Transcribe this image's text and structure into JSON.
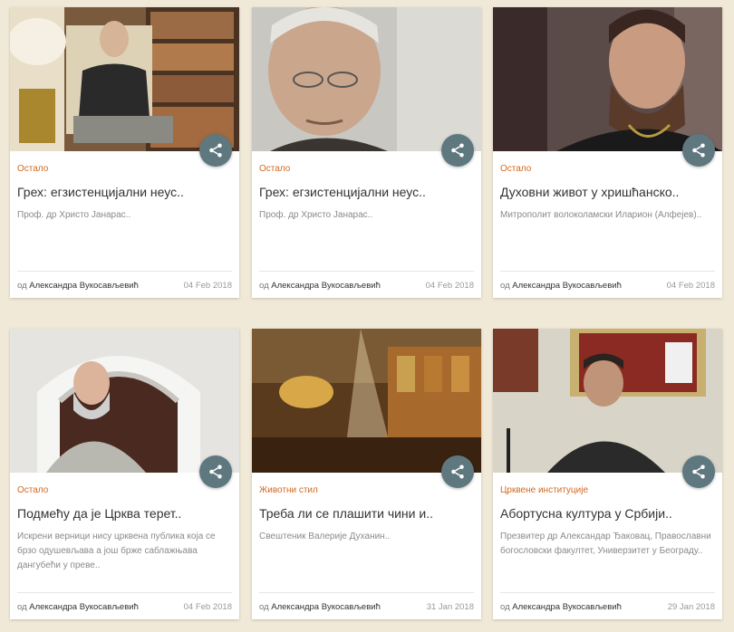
{
  "cards": [
    {
      "category": "Остало",
      "title": "Грех: егзистенцијални неус..",
      "excerpt": "Проф. др Христо Јанарас..",
      "by": "од",
      "author": "Александра Вукосављевић",
      "date": "04 Feb 2018",
      "image": "older man seated in library with bookshelves"
    },
    {
      "category": "Остало",
      "title": "Грех: егзистенцијални неус..",
      "excerpt": "Проф. др Христо Јанарас..",
      "by": "од",
      "author": "Александра Вукосављевић",
      "date": "04 Feb 2018",
      "image": "close-up portrait of older man with glasses"
    },
    {
      "category": "Остало",
      "title": "Духовни живот у хришћанско..",
      "excerpt": "Митрополит волоколамски Иларион (Алфејев)..",
      "by": "од",
      "author": "Александра Вукосављевић",
      "date": "04 Feb 2018",
      "image": "bearded orthodox clergyman in black"
    },
    {
      "category": "Остало",
      "title": "Подмећу да је Црква терет..",
      "excerpt": "Искрени верници нису црквена публика која се брзо одушевљава а још брже саблажњава дангубећи у преве..",
      "by": "од",
      "author": "Александра Вукосављевић",
      "date": "04 Feb 2018",
      "image": "priest with grey beard in front of church arch"
    },
    {
      "category": "Животни стил",
      "title": "Треба ли се плашити чини и..",
      "excerpt": "Свештеник Валерије Духанин..",
      "by": "од",
      "author": "Александра Вукосављевић",
      "date": "31 Jan 2018",
      "image": "church interior with chandelier and icons"
    },
    {
      "category": "Црквене институције",
      "title": "Абортусна култура у Србији..",
      "excerpt": "Презвитер др Александар Ђаковац, Православни богословски факултет, Универзитет у Београду..",
      "by": "од",
      "author": "Александра Вукосављевић",
      "date": "29 Jan 2018",
      "image": "speaker with glasses at microphone before icons"
    }
  ],
  "share_icon": "share-icon",
  "colors": {
    "background": "#f1e9d7",
    "category": "#d2691e",
    "share_button": "#5f7880"
  }
}
